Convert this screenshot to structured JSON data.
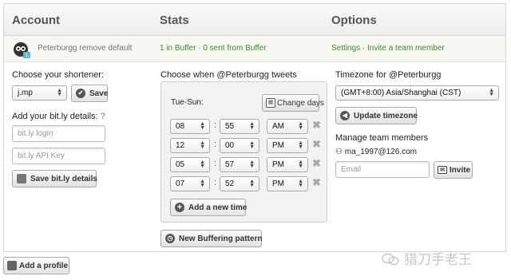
{
  "header": {
    "account": "Account",
    "stats": "Stats",
    "options": "Options"
  },
  "profile": {
    "name": "Peterburgg",
    "remove": "remove",
    "default": "default",
    "stats_buffer": "1 in Buffer",
    "stats_sep": " · ",
    "stats_sent": "0 sent from Buffer",
    "settings": "Settings",
    "invite": "Invite a team member"
  },
  "account_col": {
    "shortener_label": "Choose your shortener:",
    "shortener_value": "j.mp",
    "save_label": "Save",
    "bitly_label": "Add your bit.ly details:",
    "help": "?",
    "login_placeholder": "bit.ly login",
    "apikey_placeholder": "bit.ly API Key",
    "save_bitly_label": "Save bit.ly details"
  },
  "schedule": {
    "title": "Choose when @Peterburgg tweets",
    "days_label": "Tue-Sun:",
    "change_days": "Change days",
    "times": [
      {
        "hour": "08",
        "minute": "55",
        "ampm": "AM"
      },
      {
        "hour": "12",
        "minute": "00",
        "ampm": "PM"
      },
      {
        "hour": "05",
        "minute": "57",
        "ampm": "PM"
      },
      {
        "hour": "07",
        "minute": "52",
        "ampm": "PM"
      }
    ],
    "colon": ":",
    "add_time": "Add a new time",
    "new_pattern": "New Buffering pattern"
  },
  "options_col": {
    "timezone_label": "Timezone for @Peterburgg",
    "timezone_value": "(GMT+8:00) Asia/Shanghai (CST)",
    "update_tz": "Update timezone",
    "team_label": "Manage team members",
    "member_email": "ma_1997@126.com",
    "email_placeholder": "Email",
    "invite_btn": "Invite"
  },
  "footer": {
    "add_profile": "Add a profile"
  },
  "watermark": "猎刀手老王"
}
